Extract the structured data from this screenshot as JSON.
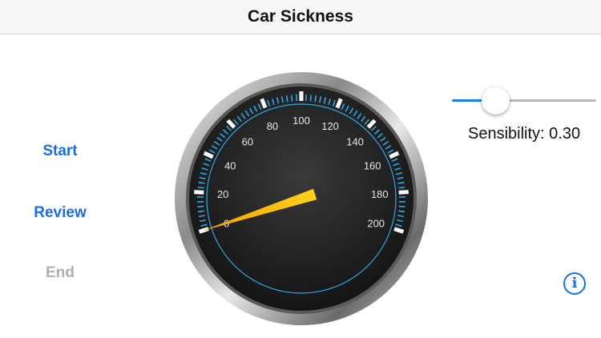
{
  "nav": {
    "title": "Car Sickness"
  },
  "side_buttons": {
    "start_label": "Start",
    "review_label": "Review",
    "end_label": "End"
  },
  "speedometer": {
    "ticks": [
      "0",
      "20",
      "40",
      "60",
      "80",
      "100",
      "120",
      "140",
      "160",
      "180",
      "200"
    ],
    "min": 0,
    "max": 200,
    "needle_value": 0
  },
  "sensitivity": {
    "slider_fraction": 0.3,
    "label": "Sensibility: 0.30"
  },
  "info": {
    "icon": "info-icon",
    "glyph": "i"
  },
  "colors": {
    "accent": "#1a6fe8",
    "disabled": "#b0b0b0",
    "needle": "#f5b800",
    "gauge_face": "#1b1b1b",
    "gauge_ring": "#2aa8e8"
  }
}
